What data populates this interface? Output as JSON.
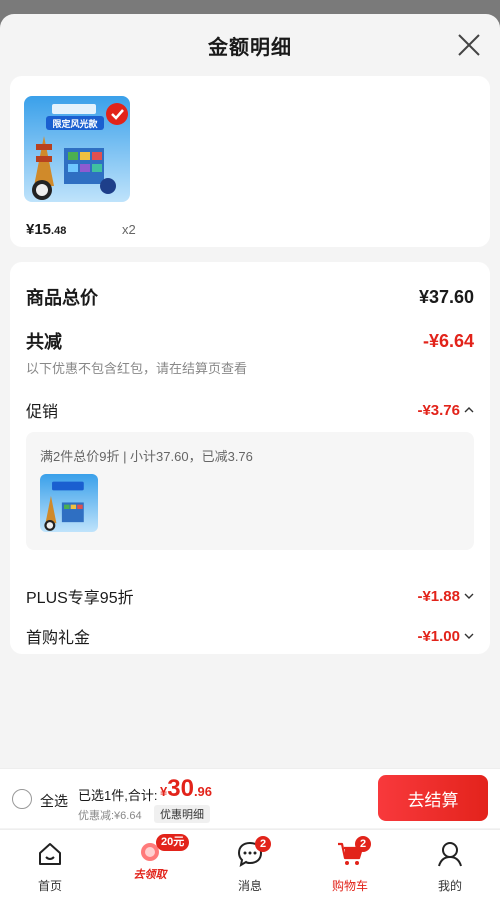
{
  "sheet": {
    "title": "金额明细"
  },
  "product": {
    "price_symbol": "¥",
    "price_int": "15",
    "price_dec": ".48",
    "quantity": "x2",
    "image_banner": "限定风光款"
  },
  "summary": {
    "goods_total_label": "商品总价",
    "goods_total_value": "¥37.60",
    "total_reduce_label": "共减",
    "total_reduce_value": "-¥6.64",
    "note": "以下优惠不包含红包，请在结算页查看",
    "promo_label": "促销",
    "promo_value": "-¥3.76",
    "promo_detail": "满2件总价9折 | 小计37.60，已减3.76",
    "plus_label": "PLUS专享95折",
    "plus_value": "-¥1.88",
    "first_buy_label": "首购礼金",
    "first_buy_value": "-¥1.00"
  },
  "checkout": {
    "select_all": "全选",
    "selected_text": "已选1件,合计:",
    "total_symbol": "¥",
    "total_int": "30",
    "total_dec": ".96",
    "discount_text": "优惠减:¥6.64",
    "detail_tag": "优惠明细",
    "button": "去结算"
  },
  "tabbar": {
    "items": [
      {
        "label": "首页",
        "icon": "home-icon"
      },
      {
        "label": "去领取",
        "icon": "coupon-icon",
        "badge": "20元"
      },
      {
        "label": "消息",
        "icon": "message-icon",
        "badge": "2"
      },
      {
        "label": "购物车",
        "icon": "cart-icon",
        "badge": "2",
        "active": true
      },
      {
        "label": "我的",
        "icon": "user-icon"
      }
    ]
  },
  "colors": {
    "accent": "#e2231a",
    "background": "#f4f4f4"
  }
}
